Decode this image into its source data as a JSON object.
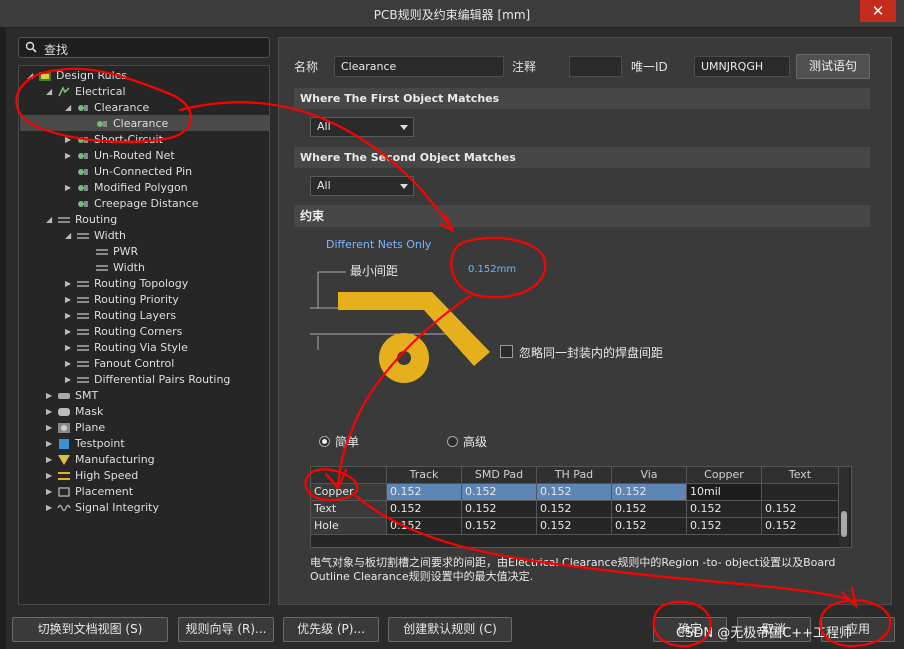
{
  "window": {
    "title": "PCB规则及约束编辑器 [mm]",
    "close_label": "✕"
  },
  "search": {
    "placeholder": "查找"
  },
  "tree": {
    "items": [
      {
        "label": "Design Rules",
        "icon": "design-rules-icon"
      },
      {
        "label": "Electrical",
        "icon": "electrical-icon"
      },
      {
        "label": "Clearance",
        "icon": "clearance-icon"
      },
      {
        "label": "Clearance",
        "icon": "clearance-rule-icon"
      },
      {
        "label": "Short-Circuit",
        "icon": "short-circuit-icon"
      },
      {
        "label": "Un-Routed Net",
        "icon": "unrouted-net-icon"
      },
      {
        "label": "Un-Connected Pin",
        "icon": "unconnected-pin-icon"
      },
      {
        "label": "Modified Polygon",
        "icon": "modified-polygon-icon"
      },
      {
        "label": "Creepage Distance",
        "icon": "creepage-icon"
      },
      {
        "label": "Routing",
        "icon": "routing-icon"
      },
      {
        "label": "Width",
        "icon": "width-icon"
      },
      {
        "label": "PWR",
        "icon": "width-rule-icon"
      },
      {
        "label": "Width",
        "icon": "width-rule-icon"
      },
      {
        "label": "Routing Topology",
        "icon": "topology-icon"
      },
      {
        "label": "Routing Priority",
        "icon": "priority-icon"
      },
      {
        "label": "Routing Layers",
        "icon": "layers-icon"
      },
      {
        "label": "Routing Corners",
        "icon": "corners-icon"
      },
      {
        "label": "Routing Via Style",
        "icon": "via-style-icon"
      },
      {
        "label": "Fanout Control",
        "icon": "fanout-icon"
      },
      {
        "label": "Differential Pairs Routing",
        "icon": "diff-pairs-icon"
      },
      {
        "label": "SMT",
        "icon": "smt-icon"
      },
      {
        "label": "Mask",
        "icon": "mask-icon"
      },
      {
        "label": "Plane",
        "icon": "plane-icon"
      },
      {
        "label": "Testpoint",
        "icon": "testpoint-icon"
      },
      {
        "label": "Manufacturing",
        "icon": "manufacturing-icon"
      },
      {
        "label": "High Speed",
        "icon": "high-speed-icon"
      },
      {
        "label": "Placement",
        "icon": "placement-icon"
      },
      {
        "label": "Signal Integrity",
        "icon": "signal-integrity-icon"
      }
    ]
  },
  "rule": {
    "name_label": "名称",
    "name_value": "Clearance",
    "comment_label": "注释",
    "comment_value": "",
    "id_label": "唯一ID",
    "id_value": "UMNJRQGH",
    "test_button": "测试语句"
  },
  "first_match": {
    "title": "Where The First Object Matches",
    "value": "All"
  },
  "second_match": {
    "title": "Where The Second Object Matches",
    "value": "All"
  },
  "constraints": {
    "title": "约束",
    "different_nets": "Different Nets Only",
    "min_clearance_label": "最小间距",
    "min_clearance_value": "0.152mm",
    "ignore_pads_label": "忽略同一封装内的焊盘间距",
    "mode_simple": "简单",
    "mode_advanced": "高级"
  },
  "grid": {
    "columns": [
      "",
      "Track",
      "SMD Pad",
      "TH Pad",
      "Via",
      "Copper",
      "Text"
    ],
    "rows": [
      {
        "name": "Copper",
        "cells": [
          "0.152",
          "0.152",
          "0.152",
          "0.152",
          "10mil",
          ""
        ]
      },
      {
        "name": "Text",
        "cells": [
          "0.152",
          "0.152",
          "0.152",
          "0.152",
          "0.152",
          "0.152"
        ]
      },
      {
        "name": "Hole",
        "cells": [
          "0.152",
          "0.152",
          "0.152",
          "0.152",
          "0.152",
          "0.152"
        ]
      }
    ]
  },
  "description": "电气对象与板切割槽之间要求的间距，由Electrical Clearance规则中的Region -to- object设置以及Board Outline Clearance规则设置中的最大值决定.",
  "buttons": {
    "doc_view": "切换到文档视图 (S)",
    "rule_wizard": "规则向导 (R)...",
    "priority": "优先级 (P)...",
    "create_default": "创建默认规则 (C)",
    "ok": "确定",
    "cancel": "取消",
    "apply": "应用"
  },
  "watermark": "CSDN @无极帝国C++工程师",
  "colors": {
    "accent_blue": "#6fb5ff",
    "pcb_yellow": "#e6b01c",
    "selection": "#5e86b5",
    "annotation_red": "#ff0000"
  }
}
